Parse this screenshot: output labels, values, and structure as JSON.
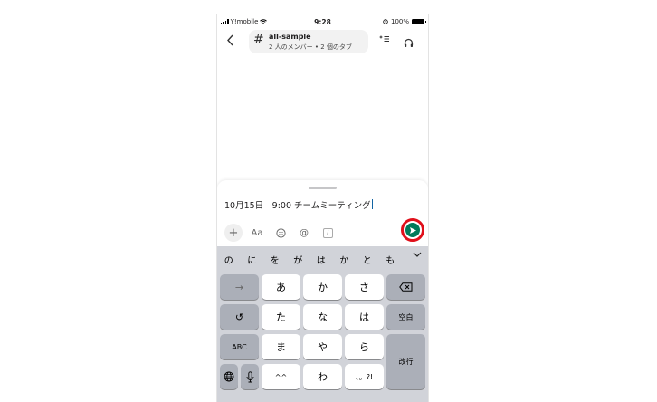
{
  "status_bar": {
    "carrier": "Y!mobile",
    "time": "9:28",
    "battery": "100%"
  },
  "header": {
    "back_icon": "chevron-left",
    "channel_name": "all-sample",
    "channel_subtitle": "2 人のメンバー • 2 個のタブ",
    "icons": [
      "sparkle-list-icon",
      "headphones-icon"
    ]
  },
  "composer": {
    "message_text": "10月15日　9:00 チームミーティング",
    "tools": {
      "plus": "+",
      "format": "Aa",
      "emoji_icon": "smiley-icon",
      "mention": "@",
      "slash_icon": "slash-command-icon"
    },
    "send_button": "send-icon",
    "highlight_color": "#e0101b",
    "send_color": "#007a5a"
  },
  "keyboard": {
    "candidates": [
      "の",
      "に",
      "を",
      "が",
      "は",
      "か",
      "と",
      "も"
    ],
    "candidate_more": "chevron-down-icon",
    "keys": {
      "arrow": "→",
      "undo": "↺",
      "abc": "ABC",
      "globe": "globe-icon",
      "mic": "mic-icon",
      "a": "あ",
      "ka": "か",
      "sa": "さ",
      "ta": "た",
      "na": "な",
      "ha": "は",
      "ma": "ま",
      "ya": "や",
      "ra": "ら",
      "dakuten": "^^",
      "wa": "わ",
      "punct": "、。?!",
      "delete": "delete-icon",
      "space": "空白",
      "enter": "改行"
    }
  }
}
